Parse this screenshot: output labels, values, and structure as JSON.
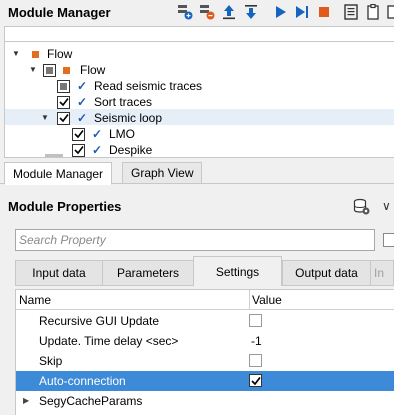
{
  "module_manager": {
    "title": "Module Manager",
    "toolbar_icons": [
      "add-module-icon",
      "remove-module-icon",
      "move-up-icon",
      "move-down-icon",
      "run-icon",
      "run-to-icon",
      "stop-icon",
      "list-icon",
      "copy-icon"
    ],
    "tree": [
      {
        "label": "Flow",
        "level": 0,
        "expander": "collapsed"
      },
      {
        "label": "Flow",
        "level": 1,
        "expander": "expanded",
        "checkbox": "partial"
      },
      {
        "label": "Read seismic traces",
        "level": 2,
        "checkbox": "partial",
        "checkmark": true
      },
      {
        "label": "Sort traces",
        "level": 2,
        "checkbox": "checked",
        "checkmark": true
      },
      {
        "label": "Seismic loop",
        "level": 2,
        "expander": "expanded",
        "checkbox": "checked",
        "checkmark": true
      },
      {
        "label": "LMO",
        "level": 3,
        "checkbox": "checked",
        "checkmark": true
      },
      {
        "label": "Despike",
        "level": 3,
        "checkbox": "checked",
        "checkmark": true
      }
    ],
    "tabs": [
      "Module Manager",
      "Graph View"
    ],
    "active_tab": "Module Manager"
  },
  "module_properties": {
    "title": "Module Properties",
    "search_placeholder": "Search Property",
    "tabs": [
      "Input data",
      "Parameters",
      "Settings",
      "Output data",
      "In"
    ],
    "active_tab": "Settings",
    "grid": {
      "col_name": "Name",
      "col_value": "Value",
      "rows": [
        {
          "name": "Recursive GUI Update",
          "value_type": "checkbox",
          "checked": false
        },
        {
          "name": "Update. Time delay <sec>",
          "value_type": "text",
          "value": "-1"
        },
        {
          "name": "Skip",
          "value_type": "checkbox",
          "checked": false
        },
        {
          "name": "Auto-connection",
          "value_type": "checkbox",
          "checked": true,
          "selected": true
        },
        {
          "name": "SegyCacheParams",
          "value_type": "group",
          "expander": "collapsed"
        }
      ]
    }
  },
  "colors": {
    "accent_selection": "#3c8ad8",
    "orange_marker": "#e07020",
    "blue_check": "#1a5fb4",
    "toolbar_blue": "#1565c0",
    "stop_orange": "#e05a1a"
  }
}
